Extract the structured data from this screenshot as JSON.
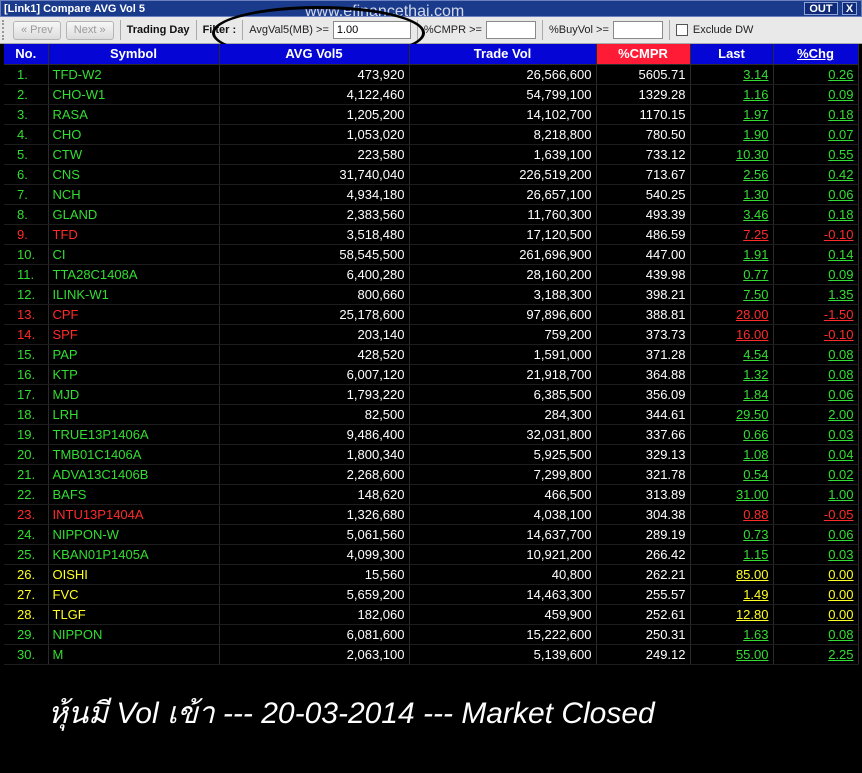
{
  "window": {
    "title": "[Link1] Compare AVG Vol 5",
    "out_label": "OUT",
    "close_label": "X"
  },
  "toolbar": {
    "prev_label": "« Prev",
    "next_label": "Next »",
    "trading_day_label": "Trading Day",
    "filter_label": "Filter :",
    "avg_label": "AvgVal5(MB) >=",
    "avg_value": "1.00",
    "cmpr_label": "%CMPR >=",
    "cmpr_value": "",
    "buyvol_label": "%BuyVol >=",
    "exclude_label": "Exclude DW"
  },
  "watermark": "www.efinancethai.com",
  "columns": [
    "No.",
    "Symbol",
    "AVG Vol5",
    "Trade Vol",
    "%CMPR",
    "Last",
    "%Chg"
  ],
  "colors": {
    "up": "#33dd33",
    "down": "#ff2a2a",
    "unchanged": "#ffff22",
    "header": "#0505d6",
    "header_highlight": "#ff1a35"
  },
  "rows": [
    {
      "no": "1.",
      "symbol": "TFD-W2",
      "avg_vol5": "473,920",
      "trade_vol": "26,566,600",
      "cmpr": "5605.71",
      "last": "3.14",
      "chg": "0.26",
      "status": "up"
    },
    {
      "no": "2.",
      "symbol": "CHO-W1",
      "avg_vol5": "4,122,460",
      "trade_vol": "54,799,100",
      "cmpr": "1329.28",
      "last": "1.16",
      "chg": "0.09",
      "status": "up"
    },
    {
      "no": "3.",
      "symbol": "RASA",
      "avg_vol5": "1,205,200",
      "trade_vol": "14,102,700",
      "cmpr": "1170.15",
      "last": "1.97",
      "chg": "0.18",
      "status": "up"
    },
    {
      "no": "4.",
      "symbol": "CHO",
      "avg_vol5": "1,053,020",
      "trade_vol": "8,218,800",
      "cmpr": "780.50",
      "last": "1.90",
      "chg": "0.07",
      "status": "up"
    },
    {
      "no": "5.",
      "symbol": "CTW",
      "avg_vol5": "223,580",
      "trade_vol": "1,639,100",
      "cmpr": "733.12",
      "last": "10.30",
      "chg": "0.55",
      "status": "up"
    },
    {
      "no": "6.",
      "symbol": "CNS",
      "avg_vol5": "31,740,040",
      "trade_vol": "226,519,200",
      "cmpr": "713.67",
      "last": "2.56",
      "chg": "0.42",
      "status": "up"
    },
    {
      "no": "7.",
      "symbol": "NCH",
      "avg_vol5": "4,934,180",
      "trade_vol": "26,657,100",
      "cmpr": "540.25",
      "last": "1.30",
      "chg": "0.06",
      "status": "up"
    },
    {
      "no": "8.",
      "symbol": "GLAND",
      "avg_vol5": "2,383,560",
      "trade_vol": "11,760,300",
      "cmpr": "493.39",
      "last": "3.46",
      "chg": "0.18",
      "status": "up"
    },
    {
      "no": "9.",
      "symbol": "TFD",
      "avg_vol5": "3,518,480",
      "trade_vol": "17,120,500",
      "cmpr": "486.59",
      "last": "7.25",
      "chg": "-0.10",
      "status": "down"
    },
    {
      "no": "10.",
      "symbol": "CI",
      "avg_vol5": "58,545,500",
      "trade_vol": "261,696,900",
      "cmpr": "447.00",
      "last": "1.91",
      "chg": "0.14",
      "status": "up"
    },
    {
      "no": "11.",
      "symbol": "TTA28C1408A",
      "avg_vol5": "6,400,280",
      "trade_vol": "28,160,200",
      "cmpr": "439.98",
      "last": "0.77",
      "chg": "0.09",
      "status": "up"
    },
    {
      "no": "12.",
      "symbol": "ILINK-W1",
      "avg_vol5": "800,660",
      "trade_vol": "3,188,300",
      "cmpr": "398.21",
      "last": "7.50",
      "chg": "1.35",
      "status": "up"
    },
    {
      "no": "13.",
      "symbol": "CPF",
      "avg_vol5": "25,178,600",
      "trade_vol": "97,896,600",
      "cmpr": "388.81",
      "last": "28.00",
      "chg": "-1.50",
      "status": "down"
    },
    {
      "no": "14.",
      "symbol": "SPF",
      "avg_vol5": "203,140",
      "trade_vol": "759,200",
      "cmpr": "373.73",
      "last": "16.00",
      "chg": "-0.10",
      "status": "down"
    },
    {
      "no": "15.",
      "symbol": "PAP",
      "avg_vol5": "428,520",
      "trade_vol": "1,591,000",
      "cmpr": "371.28",
      "last": "4.54",
      "chg": "0.08",
      "status": "up"
    },
    {
      "no": "16.",
      "symbol": "KTP",
      "avg_vol5": "6,007,120",
      "trade_vol": "21,918,700",
      "cmpr": "364.88",
      "last": "1.32",
      "chg": "0.08",
      "status": "up"
    },
    {
      "no": "17.",
      "symbol": "MJD",
      "avg_vol5": "1,793,220",
      "trade_vol": "6,385,500",
      "cmpr": "356.09",
      "last": "1.84",
      "chg": "0.06",
      "status": "up"
    },
    {
      "no": "18.",
      "symbol": "LRH",
      "avg_vol5": "82,500",
      "trade_vol": "284,300",
      "cmpr": "344.61",
      "last": "29.50",
      "chg": "2.00",
      "status": "up"
    },
    {
      "no": "19.",
      "symbol": "TRUE13P1406A",
      "avg_vol5": "9,486,400",
      "trade_vol": "32,031,800",
      "cmpr": "337.66",
      "last": "0.66",
      "chg": "0.03",
      "status": "up"
    },
    {
      "no": "20.",
      "symbol": "TMB01C1406A",
      "avg_vol5": "1,800,340",
      "trade_vol": "5,925,500",
      "cmpr": "329.13",
      "last": "1.08",
      "chg": "0.04",
      "status": "up"
    },
    {
      "no": "21.",
      "symbol": "ADVA13C1406B",
      "avg_vol5": "2,268,600",
      "trade_vol": "7,299,800",
      "cmpr": "321.78",
      "last": "0.54",
      "chg": "0.02",
      "status": "up"
    },
    {
      "no": "22.",
      "symbol": "BAFS",
      "avg_vol5": "148,620",
      "trade_vol": "466,500",
      "cmpr": "313.89",
      "last": "31.00",
      "chg": "1.00",
      "status": "up"
    },
    {
      "no": "23.",
      "symbol": "INTU13P1404A",
      "avg_vol5": "1,326,680",
      "trade_vol": "4,038,100",
      "cmpr": "304.38",
      "last": "0.88",
      "chg": "-0.05",
      "status": "down"
    },
    {
      "no": "24.",
      "symbol": "NIPPON-W",
      "avg_vol5": "5,061,560",
      "trade_vol": "14,637,700",
      "cmpr": "289.19",
      "last": "0.73",
      "chg": "0.06",
      "status": "up"
    },
    {
      "no": "25.",
      "symbol": "KBAN01P1405A",
      "avg_vol5": "4,099,300",
      "trade_vol": "10,921,200",
      "cmpr": "266.42",
      "last": "1.15",
      "chg": "0.03",
      "status": "up"
    },
    {
      "no": "26.",
      "symbol": "OISHI",
      "avg_vol5": "15,560",
      "trade_vol": "40,800",
      "cmpr": "262.21",
      "last": "85.00",
      "chg": "0.00",
      "status": "unchanged"
    },
    {
      "no": "27.",
      "symbol": "FVC",
      "avg_vol5": "5,659,200",
      "trade_vol": "14,463,300",
      "cmpr": "255.57",
      "last": "1.49",
      "chg": "0.00",
      "status": "unchanged"
    },
    {
      "no": "28.",
      "symbol": "TLGF",
      "avg_vol5": "182,060",
      "trade_vol": "459,900",
      "cmpr": "252.61",
      "last": "12.80",
      "chg": "0.00",
      "status": "unchanged"
    },
    {
      "no": "29.",
      "symbol": "NIPPON",
      "avg_vol5": "6,081,600",
      "trade_vol": "15,222,600",
      "cmpr": "250.31",
      "last": "1.63",
      "chg": "0.08",
      "status": "up"
    },
    {
      "no": "30.",
      "symbol": "M",
      "avg_vol5": "2,063,100",
      "trade_vol": "5,139,600",
      "cmpr": "249.12",
      "last": "55.00",
      "chg": "2.25",
      "status": "up"
    }
  ],
  "banner": "หุ้นมี Vol เข้า --- 20-03-2014 --- Market Closed"
}
